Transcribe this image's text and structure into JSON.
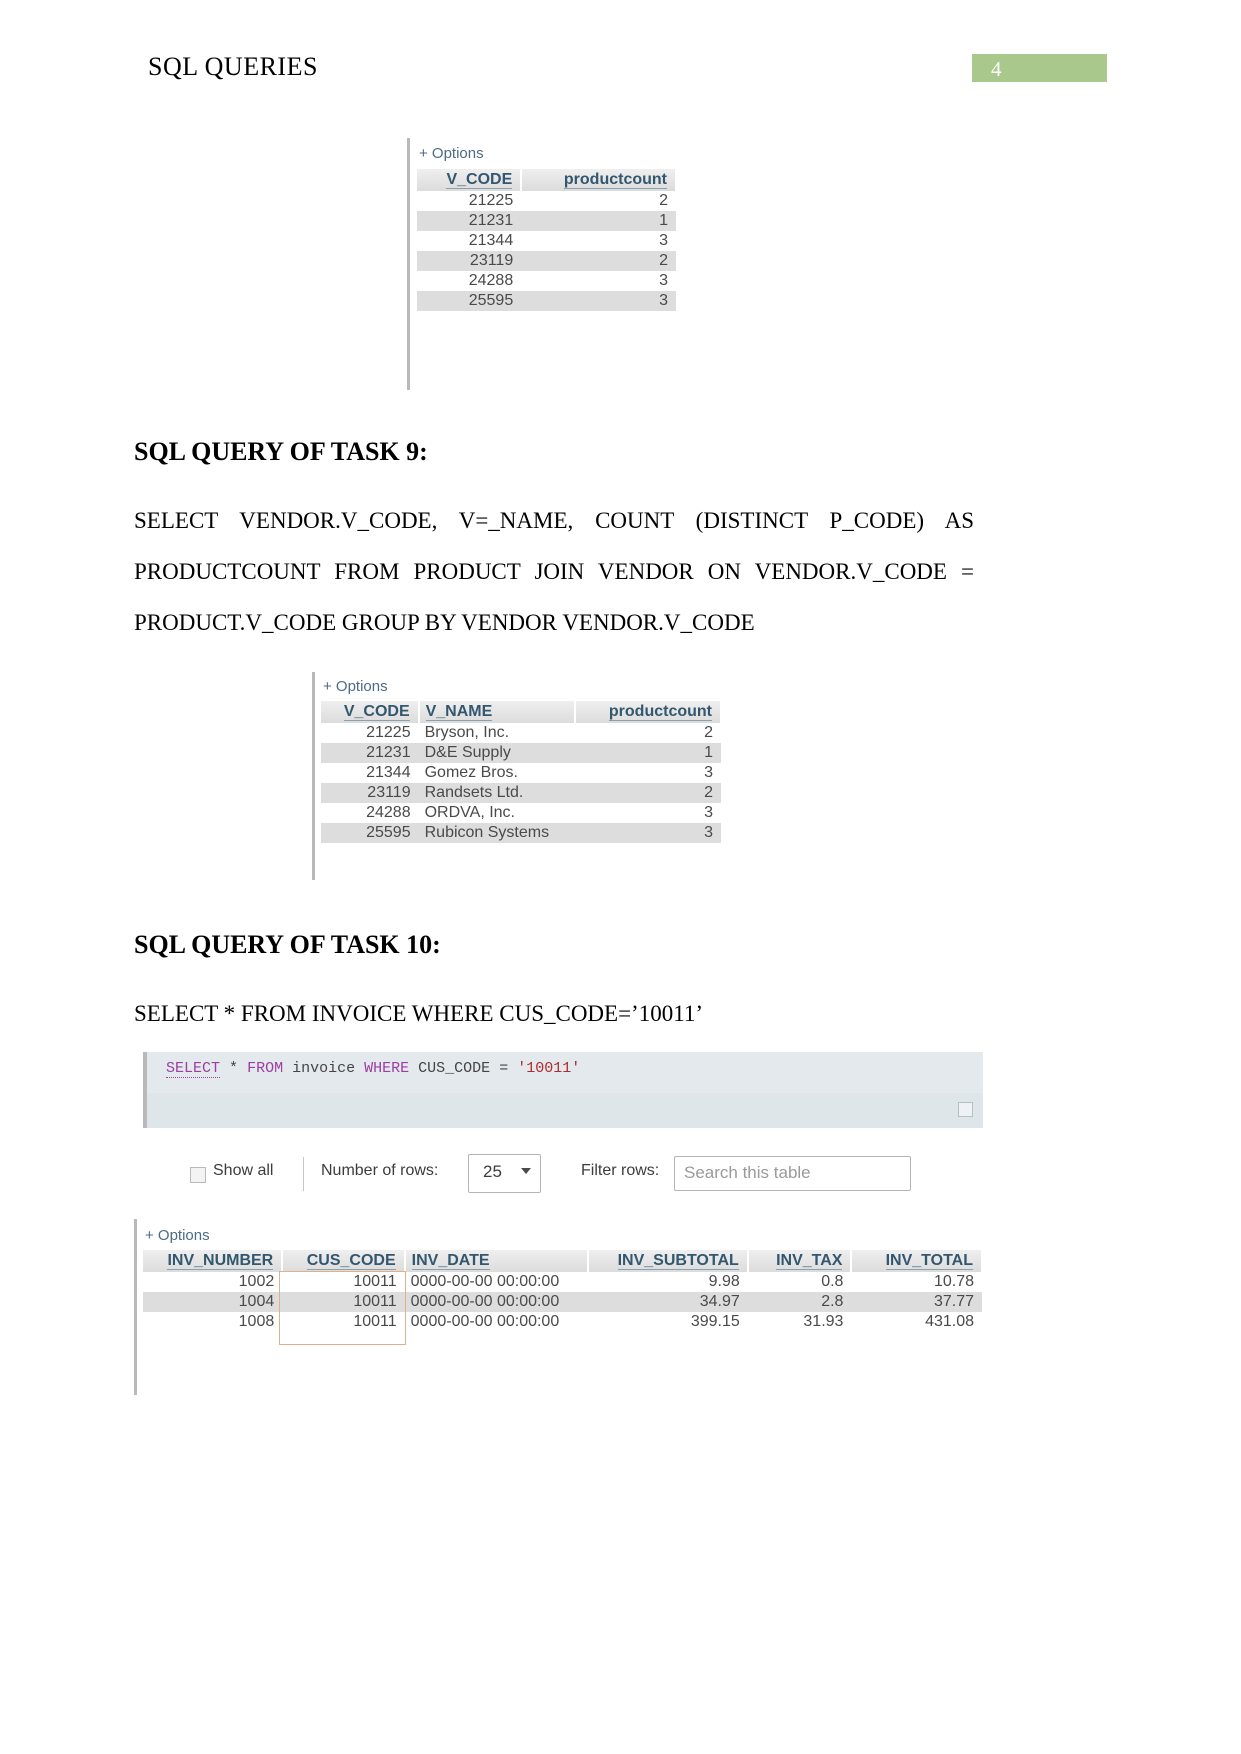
{
  "header": {
    "title": "SQL QUERIES",
    "page_number": "4",
    "badge_color": "#a8c98b"
  },
  "result_table_1": {
    "options_label": "+ Options",
    "columns": [
      "V_CODE",
      "productcount"
    ],
    "rows": [
      [
        "21225",
        "2"
      ],
      [
        "21231",
        "1"
      ],
      [
        "21344",
        "3"
      ],
      [
        "23119",
        "2"
      ],
      [
        "24288",
        "3"
      ],
      [
        "25595",
        "3"
      ]
    ]
  },
  "task9": {
    "heading": "SQL QUERY OF TASK 9:",
    "query_line1": "SELECT    VENDOR.V_CODE,    V=_NAME,    COUNT   (DISTINCT    P_CODE)    AS",
    "query_line2": "PRODUCTCOUNT   FROM   PRODUCT   JOIN   VENDOR   ON   VENDOR.V_CODE   =",
    "query_line3": "PRODUCT.V_CODE GROUP BY VENDOR VENDOR.V_CODE"
  },
  "result_table_2": {
    "options_label": "+ Options",
    "columns": [
      "V_CODE",
      "V_NAME",
      "productcount"
    ],
    "rows": [
      [
        "21225",
        "Bryson, Inc.",
        "2"
      ],
      [
        "21231",
        "D&E Supply",
        "1"
      ],
      [
        "21344",
        "Gomez Bros.",
        "3"
      ],
      [
        "23119",
        "Randsets Ltd.",
        "2"
      ],
      [
        "24288",
        "ORDVA, Inc.",
        "3"
      ],
      [
        "25595",
        "Rubicon Systems",
        "3"
      ]
    ]
  },
  "task10": {
    "heading": "SQL QUERY OF TASK 10:",
    "query_line1": "SELECT * FROM INVOICE WHERE CUS_CODE=’10011’"
  },
  "sql_console": {
    "tokens": {
      "select": "SELECT",
      "star": "*",
      "from": "FROM",
      "table": "invoice",
      "where": "WHERE",
      "column": "CUS_CODE",
      "equals": "=",
      "value": "'10011'"
    },
    "keyword_color": "#9b3fa0",
    "literal_color": "#b02b2b"
  },
  "controls": {
    "show_all_label": "Show all",
    "number_of_rows_label": "Number of rows:",
    "rows_value": "25",
    "filter_rows_label": "Filter rows:",
    "search_placeholder": "Search this table"
  },
  "result_table_3": {
    "options_label": "+ Options",
    "columns": [
      "INV_NUMBER",
      "CUS_CODE",
      "INV_DATE",
      "INV_SUBTOTAL",
      "INV_TAX",
      "INV_TOTAL"
    ],
    "rows": [
      [
        "1002",
        "10011",
        "0000-00-00 00:00:00",
        "9.98",
        "0.8",
        "10.78"
      ],
      [
        "1004",
        "10011",
        "0000-00-00 00:00:00",
        "34.97",
        "2.8",
        "37.77"
      ],
      [
        "1008",
        "10011",
        "0000-00-00 00:00:00",
        "399.15",
        "31.93",
        "431.08"
      ]
    ],
    "highlight_color": "#e0b089"
  }
}
